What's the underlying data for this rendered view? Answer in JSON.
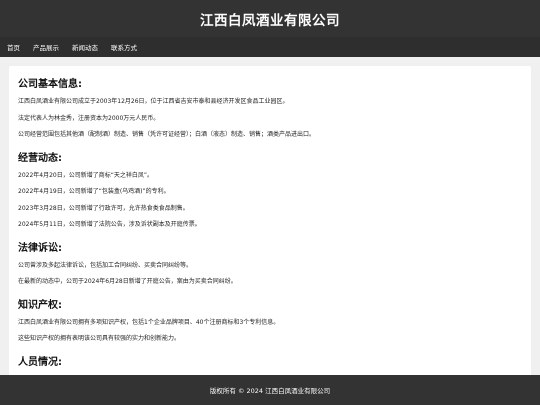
{
  "header": {
    "title": "江西白凤酒业有限公司"
  },
  "nav": {
    "items": [
      "首页",
      "产品展示",
      "新闻动态",
      "联系方式"
    ]
  },
  "sections": [
    {
      "heading": "公司基本信息:",
      "paragraphs": [
        "江西白凤酒业有限公司成立于2003年12月26日，位于江西省吉安市泰和县经济开发区食品工业园区。",
        "法定代表人为林金秀，注册资本为2000万元人民币。",
        "公司经营范围包括其他酒（配制酒）制造、销售（凭许可证经营）；白酒（液态）制造、销售；酒类产品进出口。"
      ]
    },
    {
      "heading": "经营动态:",
      "paragraphs": [
        "2022年4月20日，公司新增了商标“天之祥白凤”。",
        "2022年4月19日，公司新增了“包装盒(乌鸡酒)”的专利。",
        "2023年3月28日，公司新增了行政许可，允许热食类食品制售。",
        "2024年5月11日，公司新增了法院公告，涉及诉状副本及开庭传票。"
      ]
    },
    {
      "heading": "法律诉讼:",
      "paragraphs": [
        "公司曾涉及多起法律诉讼，包括加工合同纠纷、买卖合同纠纷等。",
        "在最新的动态中，公司于2024年6月28日新增了开庭公告，案由为买卖合同纠纷。"
      ]
    },
    {
      "heading": "知识产权:",
      "paragraphs": [
        "江西白凤酒业有限公司拥有多项知识产权，包括1个企业品牌项目、40个注册商标和3个专利信息。",
        "这些知识产权的拥有表明该公司具有较强的实力和创新能力。"
      ]
    },
    {
      "heading": "人员情况:",
      "paragraphs": []
    }
  ],
  "footer": {
    "text": "版权所有 © 2024 江西白凤酒业有限公司"
  }
}
